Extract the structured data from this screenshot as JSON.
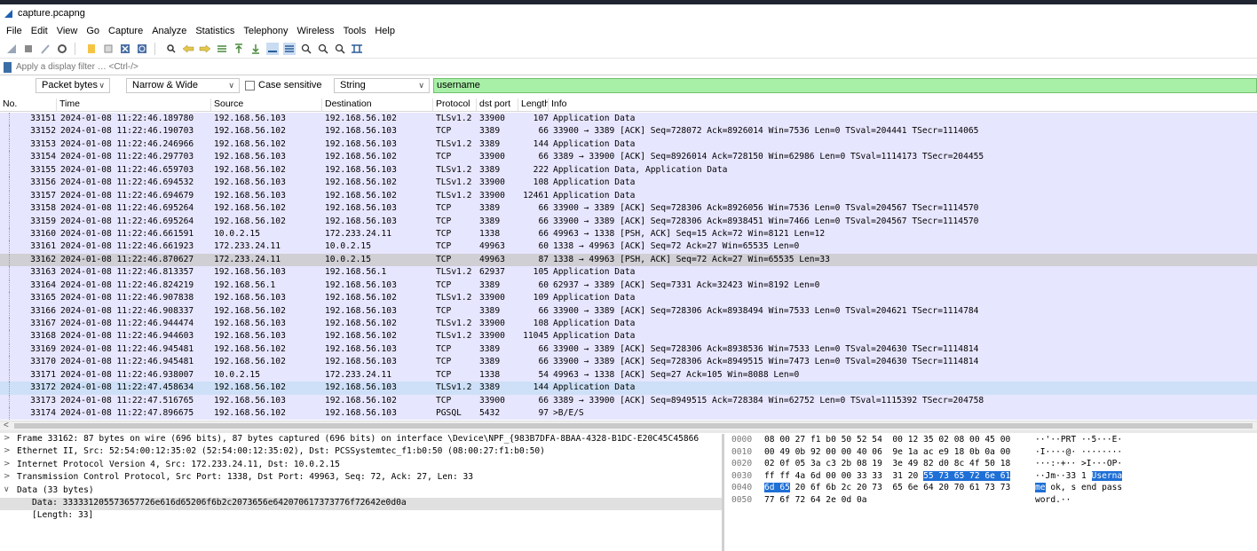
{
  "window": {
    "title": "capture.pcapng"
  },
  "menu": [
    "File",
    "Edit",
    "View",
    "Go",
    "Capture",
    "Analyze",
    "Statistics",
    "Telephony",
    "Wireless",
    "Tools",
    "Help"
  ],
  "toolbar_icons": [
    "start-capture-icon",
    "stop-capture-icon",
    "restart-capture-icon",
    "capture-options-icon",
    "open-file-icon",
    "save-file-icon",
    "close-file-icon",
    "reload-icon",
    "find-packet-icon",
    "go-back-icon",
    "go-forward-icon",
    "go-to-packet-icon",
    "go-first-icon",
    "go-last-icon",
    "autoscroll-icon",
    "colorize-icon",
    "zoom-in-icon",
    "zoom-out-icon",
    "zoom-normal-icon",
    "resize-columns-icon"
  ],
  "filter": {
    "placeholder": "Apply a display filter … <Ctrl-/>"
  },
  "find": {
    "search_in": "Packet bytes",
    "char_width": "Narrow & Wide",
    "case_label": "Case sensitive",
    "search_type": "String",
    "value": "username"
  },
  "columns": [
    "No.",
    "Time",
    "Source",
    "Destination",
    "Protocol",
    "dst port",
    "Length",
    "Info"
  ],
  "packets": [
    {
      "no": "33151",
      "time": "2024-01-08 11:22:46.189780",
      "src": "192.168.56.103",
      "dst": "192.168.56.102",
      "proto": "TLSv1.2",
      "port": "33900",
      "len": "107",
      "info": "Application Data"
    },
    {
      "no": "33152",
      "time": "2024-01-08 11:22:46.190703",
      "src": "192.168.56.102",
      "dst": "192.168.56.103",
      "proto": "TCP",
      "port": "3389",
      "len": "66",
      "info": "33900 → 3389 [ACK] Seq=728072 Ack=8926014 Win=7536 Len=0 TSval=204441 TSecr=1114065"
    },
    {
      "no": "33153",
      "time": "2024-01-08 11:22:46.246966",
      "src": "192.168.56.102",
      "dst": "192.168.56.103",
      "proto": "TLSv1.2",
      "port": "3389",
      "len": "144",
      "info": "Application Data"
    },
    {
      "no": "33154",
      "time": "2024-01-08 11:22:46.297703",
      "src": "192.168.56.103",
      "dst": "192.168.56.102",
      "proto": "TCP",
      "port": "33900",
      "len": "66",
      "info": "3389 → 33900 [ACK] Seq=8926014 Ack=728150 Win=62986 Len=0 TSval=1114173 TSecr=204455"
    },
    {
      "no": "33155",
      "time": "2024-01-08 11:22:46.659703",
      "src": "192.168.56.102",
      "dst": "192.168.56.103",
      "proto": "TLSv1.2",
      "port": "3389",
      "len": "222",
      "info": "Application Data, Application Data"
    },
    {
      "no": "33156",
      "time": "2024-01-08 11:22:46.694532",
      "src": "192.168.56.103",
      "dst": "192.168.56.102",
      "proto": "TLSv1.2",
      "port": "33900",
      "len": "108",
      "info": "Application Data"
    },
    {
      "no": "33157",
      "time": "2024-01-08 11:22:46.694679",
      "src": "192.168.56.103",
      "dst": "192.168.56.102",
      "proto": "TLSv1.2",
      "port": "33900",
      "len": "12461",
      "info": "Application Data"
    },
    {
      "no": "33158",
      "time": "2024-01-08 11:22:46.695264",
      "src": "192.168.56.102",
      "dst": "192.168.56.103",
      "proto": "TCP",
      "port": "3389",
      "len": "66",
      "info": "33900 → 3389 [ACK] Seq=728306 Ack=8926056 Win=7536 Len=0 TSval=204567 TSecr=1114570"
    },
    {
      "no": "33159",
      "time": "2024-01-08 11:22:46.695264",
      "src": "192.168.56.102",
      "dst": "192.168.56.103",
      "proto": "TCP",
      "port": "3389",
      "len": "66",
      "info": "33900 → 3389 [ACK] Seq=728306 Ack=8938451 Win=7466 Len=0 TSval=204567 TSecr=1114570"
    },
    {
      "no": "33160",
      "time": "2024-01-08 11:22:46.661591",
      "src": "10.0.2.15",
      "dst": "172.233.24.11",
      "proto": "TCP",
      "port": "1338",
      "len": "66",
      "info": "49963 → 1338 [PSH, ACK] Seq=15 Ack=72 Win=8121 Len=12"
    },
    {
      "no": "33161",
      "time": "2024-01-08 11:22:46.661923",
      "src": "172.233.24.11",
      "dst": "10.0.2.15",
      "proto": "TCP",
      "port": "49963",
      "len": "60",
      "info": "1338 → 49963 [ACK] Seq=72 Ack=27 Win=65535 Len=0"
    },
    {
      "no": "33162",
      "time": "2024-01-08 11:22:46.870627",
      "src": "172.233.24.11",
      "dst": "10.0.2.15",
      "proto": "TCP",
      "port": "49963",
      "len": "87",
      "info": "1338 → 49963 [PSH, ACK] Seq=72 Ack=27 Win=65535 Len=33"
    },
    {
      "no": "33163",
      "time": "2024-01-08 11:22:46.813357",
      "src": "192.168.56.103",
      "dst": "192.168.56.1",
      "proto": "TLSv1.2",
      "port": "62937",
      "len": "105",
      "info": "Application Data"
    },
    {
      "no": "33164",
      "time": "2024-01-08 11:22:46.824219",
      "src": "192.168.56.1",
      "dst": "192.168.56.103",
      "proto": "TCP",
      "port": "3389",
      "len": "60",
      "info": "62937 → 3389 [ACK] Seq=7331 Ack=32423 Win=8192 Len=0"
    },
    {
      "no": "33165",
      "time": "2024-01-08 11:22:46.907838",
      "src": "192.168.56.103",
      "dst": "192.168.56.102",
      "proto": "TLSv1.2",
      "port": "33900",
      "len": "109",
      "info": "Application Data"
    },
    {
      "no": "33166",
      "time": "2024-01-08 11:22:46.908337",
      "src": "192.168.56.102",
      "dst": "192.168.56.103",
      "proto": "TCP",
      "port": "3389",
      "len": "66",
      "info": "33900 → 3389 [ACK] Seq=728306 Ack=8938494 Win=7533 Len=0 TSval=204621 TSecr=1114784"
    },
    {
      "no": "33167",
      "time": "2024-01-08 11:22:46.944474",
      "src": "192.168.56.103",
      "dst": "192.168.56.102",
      "proto": "TLSv1.2",
      "port": "33900",
      "len": "108",
      "info": "Application Data"
    },
    {
      "no": "33168",
      "time": "2024-01-08 11:22:46.944603",
      "src": "192.168.56.103",
      "dst": "192.168.56.102",
      "proto": "TLSv1.2",
      "port": "33900",
      "len": "11045",
      "info": "Application Data"
    },
    {
      "no": "33169",
      "time": "2024-01-08 11:22:46.945481",
      "src": "192.168.56.102",
      "dst": "192.168.56.103",
      "proto": "TCP",
      "port": "3389",
      "len": "66",
      "info": "33900 → 3389 [ACK] Seq=728306 Ack=8938536 Win=7533 Len=0 TSval=204630 TSecr=1114814"
    },
    {
      "no": "33170",
      "time": "2024-01-08 11:22:46.945481",
      "src": "192.168.56.102",
      "dst": "192.168.56.103",
      "proto": "TCP",
      "port": "3389",
      "len": "66",
      "info": "33900 → 3389 [ACK] Seq=728306 Ack=8949515 Win=7473 Len=0 TSval=204630 TSecr=1114814"
    },
    {
      "no": "33171",
      "time": "2024-01-08 11:22:46.938007",
      "src": "10.0.2.15",
      "dst": "172.233.24.11",
      "proto": "TCP",
      "port": "1338",
      "len": "54",
      "info": "49963 → 1338 [ACK] Seq=27 Ack=105 Win=8088 Len=0"
    },
    {
      "no": "33172",
      "time": "2024-01-08 11:22:47.458634",
      "src": "192.168.56.102",
      "dst": "192.168.56.103",
      "proto": "TLSv1.2",
      "port": "3389",
      "len": "144",
      "info": "Application Data"
    },
    {
      "no": "33173",
      "time": "2024-01-08 11:22:47.516765",
      "src": "192.168.56.103",
      "dst": "192.168.56.102",
      "proto": "TCP",
      "port": "33900",
      "len": "66",
      "info": "3389 → 33900 [ACK] Seq=8949515 Ack=728384 Win=62752 Len=0 TSval=1115392 TSecr=204758"
    },
    {
      "no": "33174",
      "time": "2024-01-08 11:22:47.896675",
      "src": "192.168.56.102",
      "dst": "192.168.56.103",
      "proto": "PGSQL",
      "port": "5432",
      "len": "97",
      "info": ">B/E/S"
    }
  ],
  "selected_packet": "33162",
  "details": [
    {
      "toggle": ">",
      "text": "Frame 33162: 87 bytes on wire (696 bits), 87 bytes captured (696 bits) on interface \\Device\\NPF_{983B7DFA-8BAA-4328-B1DC-E20C45C45866"
    },
    {
      "toggle": ">",
      "text": "Ethernet II, Src: 52:54:00:12:35:02 (52:54:00:12:35:02), Dst: PCSSystemtec_f1:b0:50 (08:00:27:f1:b0:50)"
    },
    {
      "toggle": ">",
      "text": "Internet Protocol Version 4, Src: 172.233.24.11, Dst: 10.0.2.15"
    },
    {
      "toggle": ">",
      "text": "Transmission Control Protocol, Src Port: 1338, Dst Port: 49963, Seq: 72, Ack: 27, Len: 33"
    },
    {
      "toggle": "∨",
      "text": "Data (33 bytes)"
    },
    {
      "toggle": "",
      "text": "Data: 333331205573657726e616d65206f6b2c2073656e642070617373776f72642e0d0a"
    },
    {
      "toggle": "",
      "text": "[Length: 33]"
    }
  ],
  "hex": [
    {
      "off": "0000",
      "hex": "08 00 27 f1 b0 50 52 54  00 12 35 02 08 00 45 00",
      "ascii": "··'··PRT ··5···E·"
    },
    {
      "off": "0010",
      "hex": "00 49 0b 92 00 00 40 06  9e 1a ac e9 18 0b 0a 00",
      "ascii": "·I····@· ········"
    },
    {
      "off": "0020",
      "hex": "02 0f 05 3a c3 2b 08 19  3e 49 82 d0 8c 4f 50 18",
      "ascii": "···:·+·· >I···OP·"
    },
    {
      "off": "0030",
      "hex_pre": "ff ff 4a 6d 00 00 33 33  31 20 ",
      "hex_mark": "55 73 65 72 6e 61",
      "hex_post": "",
      "ascii_pre": "··Jm··33 1 ",
      "ascii_mark": "Userna",
      "ascii_post": ""
    },
    {
      "off": "0040",
      "hex_pre": "",
      "hex_mark": "6d 65",
      "hex_post": " 20 6f 6b 2c 20 73  65 6e 64 20 70 61 73 73",
      "ascii_pre": "",
      "ascii_mark": "me",
      "ascii_post": " ok, s end pass"
    },
    {
      "off": "0050",
      "hex": "77 6f 72 64 2e 0d 0a",
      "ascii": "word.··"
    }
  ]
}
